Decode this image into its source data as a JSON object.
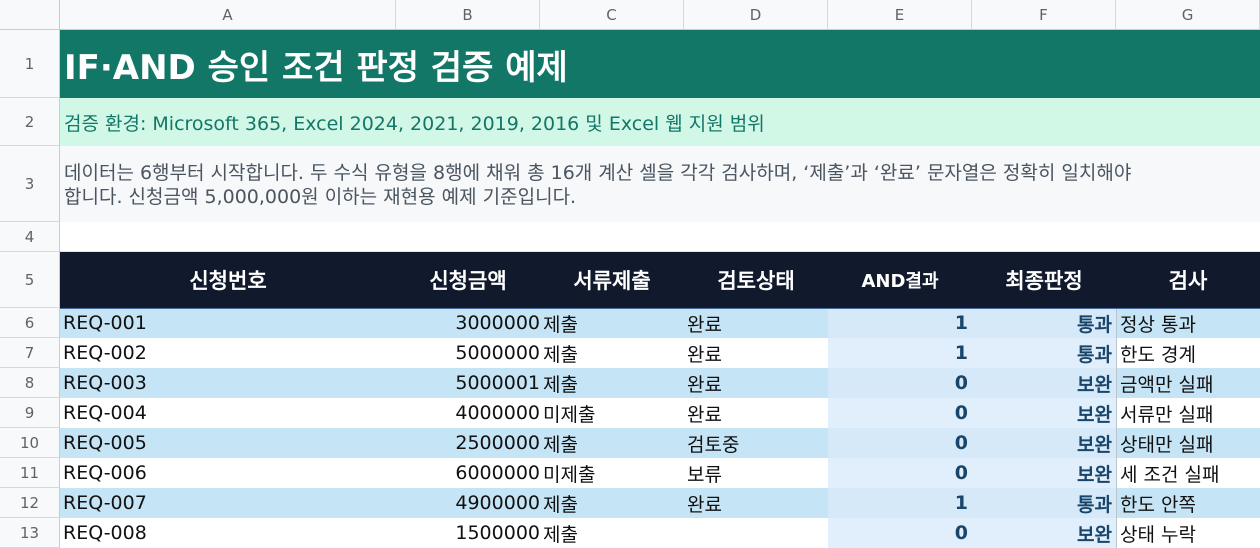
{
  "columns": [
    "A",
    "B",
    "C",
    "D",
    "E",
    "F",
    "G"
  ],
  "rows": [
    "1",
    "2",
    "3",
    "4",
    "5",
    "6",
    "7",
    "8",
    "9",
    "10",
    "11",
    "12",
    "13"
  ],
  "title": "IF·AND 승인 조건 판정 검증 예제",
  "env": "검증 환경: Microsoft 365, Excel 2024, 2021, 2019, 2016 및 Excel 웹 지원 범위",
  "desc_line1": "데이터는 6행부터 시작합니다. 두 수식 유형을 8행에 채워 총 16개 계산 셀을 각각 검사하며, ‘제출’과 ‘완료’ 문자열은 정확히 일치해야",
  "desc_line2": "합니다. 신청금액 5,000,000원 이하는 재현용 예제 기준입니다.",
  "headers": {
    "id": "신청번호",
    "amount": "신청금액",
    "docs": "서류제출",
    "status": "검토상태",
    "and_result": "AND결과",
    "final": "최종판정",
    "check": "검사"
  },
  "table": [
    {
      "id": "REQ-001",
      "amount": "3000000",
      "docs": "제출",
      "status": "완료",
      "and_result": "1",
      "final": "통과",
      "check": "정상 통과"
    },
    {
      "id": "REQ-002",
      "amount": "5000000",
      "docs": "제출",
      "status": "완료",
      "and_result": "1",
      "final": "통과",
      "check": "한도 경계"
    },
    {
      "id": "REQ-003",
      "amount": "5000001",
      "docs": "제출",
      "status": "완료",
      "and_result": "0",
      "final": "보완",
      "check": "금액만 실패"
    },
    {
      "id": "REQ-004",
      "amount": "4000000",
      "docs": "미제출",
      "status": "완료",
      "and_result": "0",
      "final": "보완",
      "check": "서류만 실패"
    },
    {
      "id": "REQ-005",
      "amount": "2500000",
      "docs": "제출",
      "status": "검토중",
      "and_result": "0",
      "final": "보완",
      "check": "상태만 실패"
    },
    {
      "id": "REQ-006",
      "amount": "6000000",
      "docs": "미제출",
      "status": "보류",
      "and_result": "0",
      "final": "보완",
      "check": "세 조건 실패"
    },
    {
      "id": "REQ-007",
      "amount": "4900000",
      "docs": "제출",
      "status": "완료",
      "and_result": "1",
      "final": "통과",
      "check": "한도 안쪽"
    },
    {
      "id": "REQ-008",
      "amount": "1500000",
      "docs": "제출",
      "status": "",
      "and_result": "0",
      "final": "보완",
      "check": "상태 누락"
    }
  ]
}
